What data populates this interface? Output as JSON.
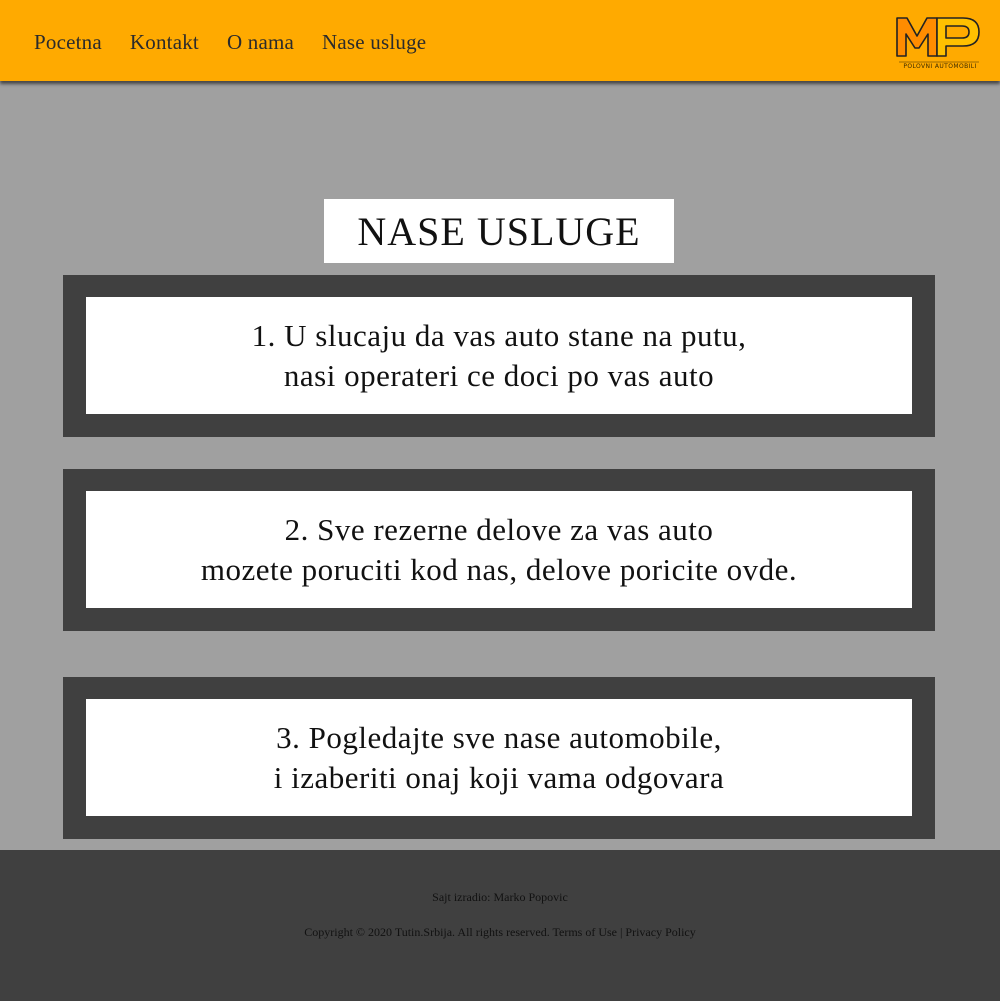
{
  "nav": {
    "items": [
      "Pocetna",
      "Kontakt",
      "O nama",
      "Nase usluge"
    ]
  },
  "logo": {
    "letters": "MP",
    "subtitle": "POLOVNI AUTOMOBILI",
    "colors": {
      "m": "#ff8c00",
      "p": "#ffc000",
      "outline": "#222222"
    }
  },
  "main": {
    "title": "NASE USLUGE",
    "services": [
      {
        "line1": "1. U slucaju da vas auto stane na putu,",
        "line2": "nasi operateri ce doci po vas auto"
      },
      {
        "line1": "2. Sve rezerne delove za vas auto",
        "line2": "mozete poruciti kod nas, delove poricite ovde."
      },
      {
        "line1": "3. Pogledajte sve  nase automobile,",
        "line2": "i izaberiti onaj koji vama odgovara"
      }
    ]
  },
  "footer": {
    "author": "Sajt izradio: Marko Popovic",
    "copyright": "Copyright © 2020 Tutin.Srbija. All rights reserved.",
    "terms": "Terms of Use",
    "separator": "|",
    "privacy": "Privacy Policy"
  },
  "colors": {
    "header_bg": "#ffaa00",
    "page_bg": "#a0a0a0",
    "card_border": "#404040",
    "footer_bg": "#404040"
  }
}
